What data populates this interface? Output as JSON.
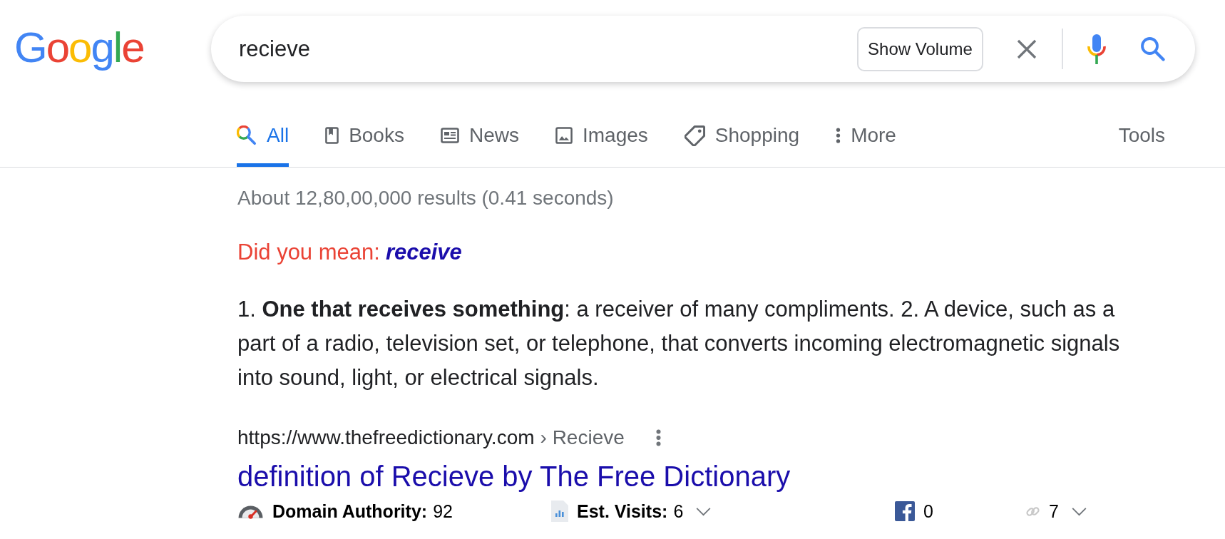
{
  "logo": {
    "text": "Google"
  },
  "search": {
    "value": "recieve",
    "volume_button": "Show Volume"
  },
  "tabs": [
    {
      "kind": "all",
      "label": "All",
      "selected": true
    },
    {
      "kind": "books",
      "label": "Books",
      "selected": false
    },
    {
      "kind": "news",
      "label": "News",
      "selected": false
    },
    {
      "kind": "images",
      "label": "Images",
      "selected": false
    },
    {
      "kind": "shopping",
      "label": "Shopping",
      "selected": false
    },
    {
      "kind": "more",
      "label": "More",
      "selected": false
    }
  ],
  "tools": "Tools",
  "result_stats": "About 12,80,00,000 results (0.41 seconds)",
  "spelling": {
    "prompt": "Did you mean:",
    "suggestion": "receive"
  },
  "definition": "1. **One that receives something**: a receiver of many compliments. 2. A device, such as a part of a radio, television set, or telephone, that converts incoming electromagnetic signals into sound, light, or electrical signals.",
  "result": {
    "url": "https://www.thefreedictionary.com",
    "breadcrumb": "› Recieve",
    "title": "definition of Recieve by The Free Dictionary"
  },
  "metrics": [
    {
      "kind": "domain_authority",
      "label": "Domain Authority:",
      "value": "92",
      "expandable": false
    },
    {
      "kind": "visits",
      "label": "Est. Visits:",
      "value": "6",
      "expandable": true
    },
    {
      "kind": "facebook",
      "value": "0",
      "expandable": false
    },
    {
      "kind": "links",
      "value": "7",
      "expandable": true
    }
  ]
}
